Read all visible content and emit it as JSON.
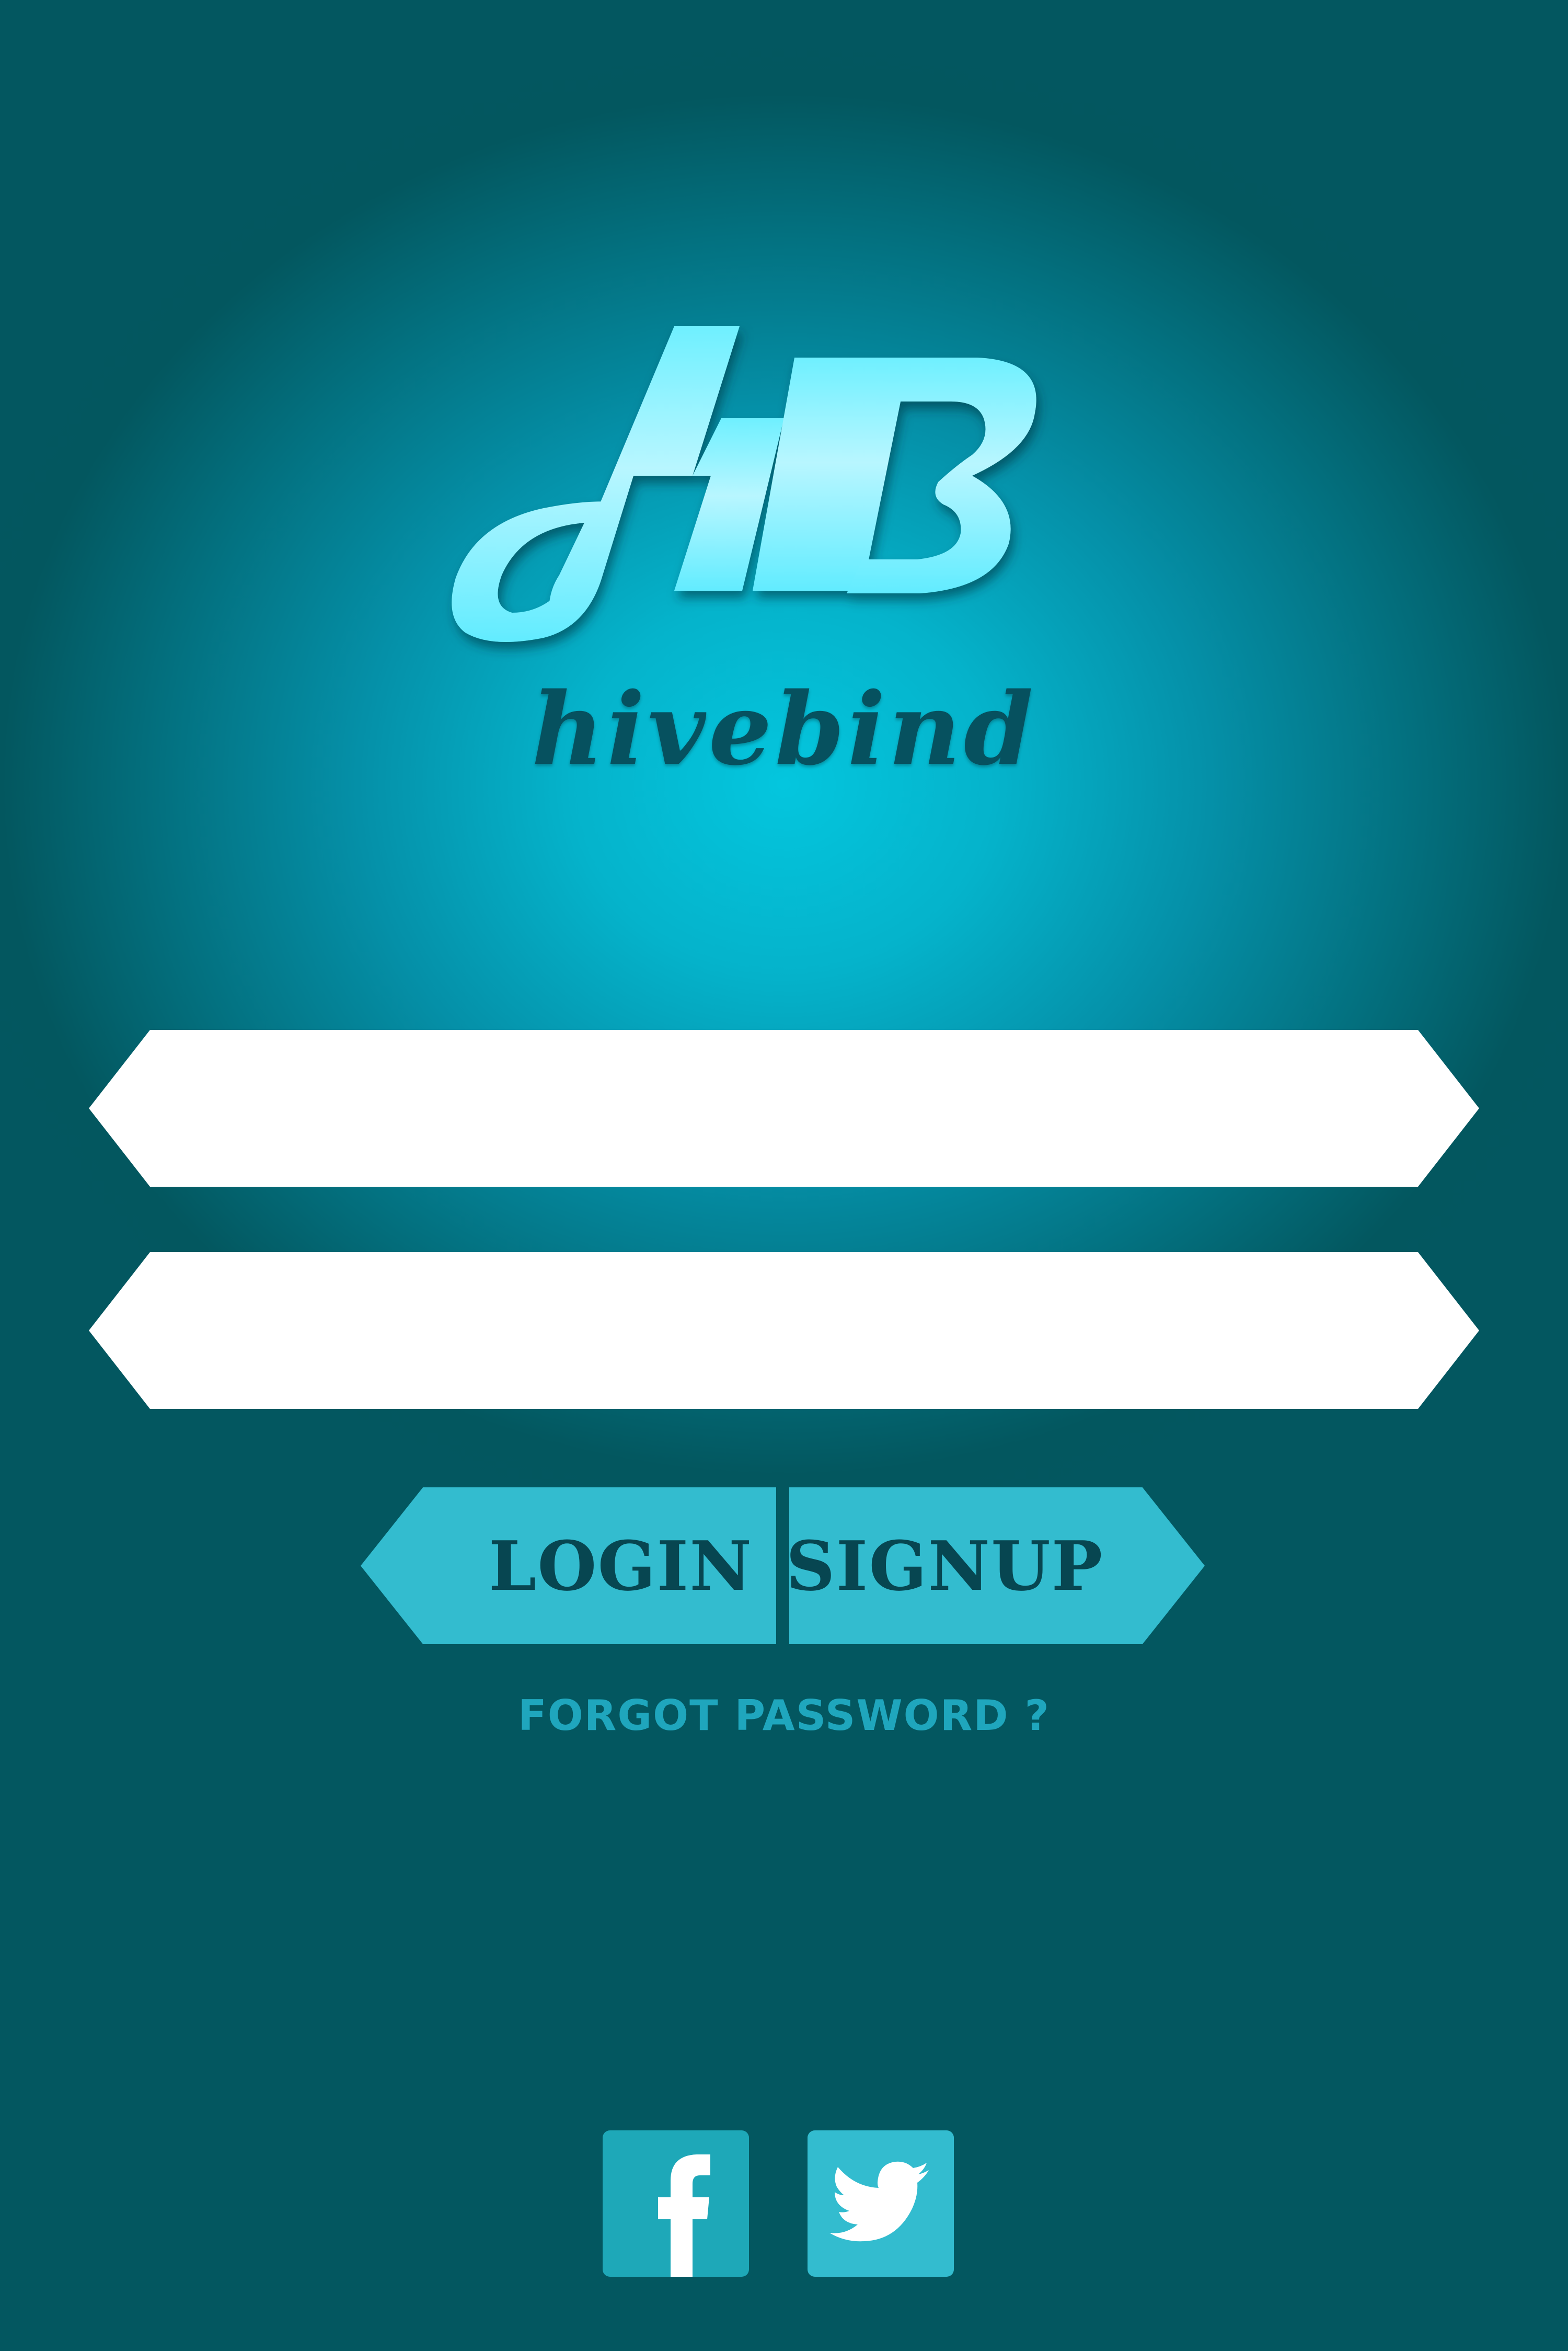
{
  "brand": {
    "logo_monogram": "HB",
    "wordmark": "hivebind"
  },
  "form": {
    "username": {
      "value": "",
      "placeholder": ""
    },
    "password": {
      "value": "",
      "placeholder": ""
    }
  },
  "actions": {
    "login_label": "LOGIN",
    "signup_label": "SIGNUP",
    "forgot_label": "FORGOT PASSWORD ?"
  },
  "social": [
    {
      "name": "facebook",
      "icon": "facebook-icon"
    },
    {
      "name": "twitter",
      "icon": "twitter-icon"
    }
  ],
  "colors": {
    "background_center": "#04c6de",
    "background_edge": "#035760",
    "logo_gradient_top": "#6ff0ff",
    "logo_gradient_mid": "#b8f6ff",
    "wordmark": "#06515f",
    "button": "#33bccf",
    "button_text": "#074651",
    "forgot_text": "#1fa6bd",
    "facebook_tile": "#1ea8b8",
    "twitter_tile": "#33bccf"
  }
}
